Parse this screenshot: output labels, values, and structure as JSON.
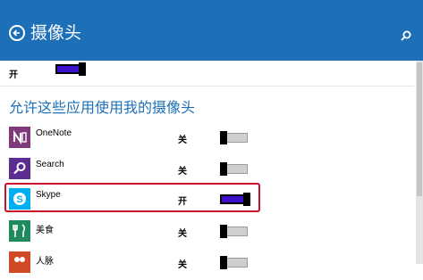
{
  "header": {
    "title": "摄像头",
    "bg_color": "#1d6fb7"
  },
  "top_setting": {
    "state": "开",
    "on": true
  },
  "section_title": "允许这些应用使用我的摄像头",
  "apps": [
    {
      "name": "OneNote",
      "state": "关",
      "on": false,
      "icon": "onenote-icon",
      "icon_color": "#80397b"
    },
    {
      "name": "Search",
      "state": "关",
      "on": false,
      "icon": "search-icon",
      "icon_color": "#5c2d91"
    },
    {
      "name": "Skype",
      "state": "开",
      "on": true,
      "icon": "skype-icon",
      "icon_color": "#00aff0"
    },
    {
      "name": "美食",
      "state": "关",
      "on": false,
      "icon": "food-icon",
      "icon_color": "#1f8a5d"
    },
    {
      "name": "人脉",
      "state": "关",
      "on": false,
      "icon": "people-icon",
      "icon_color": "#d04a26"
    }
  ],
  "highlight_color": "#c8102e",
  "toggle_on_color": "#3c10c8"
}
